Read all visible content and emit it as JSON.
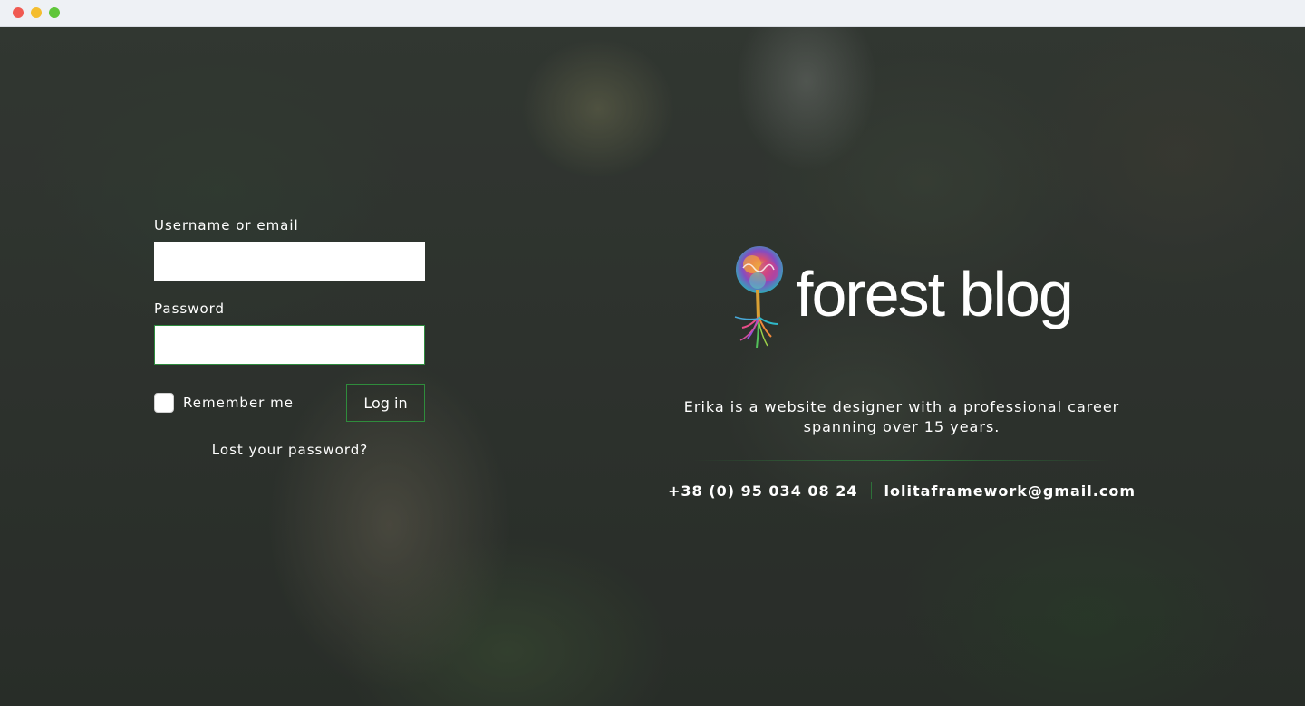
{
  "form": {
    "username_label": "Username or email",
    "username_value": "",
    "password_label": "Password",
    "password_value": "",
    "remember_label": "Remember me",
    "remember_checked": false,
    "login_label": "Log in",
    "lost_password_label": "Lost your password?"
  },
  "brand": {
    "logo_text": "forest blog",
    "logo_icon": "tree-icon",
    "bio": "Erika is a website designer with a professional career spanning over 15 years.",
    "phone": "+38 (0) 95 034 08 24",
    "email": "lolitaframework@gmail.com"
  },
  "colors": {
    "accent": "#2e8b3e",
    "text": "#ffffff"
  }
}
